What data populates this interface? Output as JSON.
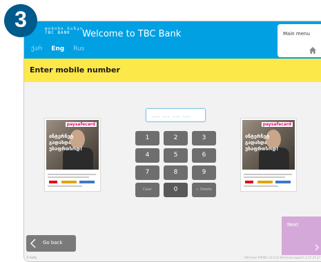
{
  "step_badge": "3",
  "header": {
    "logo_top": "თიბისი ბანკი",
    "logo_bottom": "TBC BANK",
    "welcome": "Welcome to TBC Bank",
    "languages": [
      {
        "label": "ქარ",
        "active": false
      },
      {
        "label": "Eng",
        "active": true
      },
      {
        "label": "Rus",
        "active": false
      }
    ],
    "main_menu": "Main menu",
    "home_icon": "home-icon"
  },
  "banner": {
    "title": "Enter mobile number"
  },
  "phone_input": {
    "mask": "___ ___ ___ ___"
  },
  "keypad": {
    "keys": [
      "1",
      "2",
      "3",
      "4",
      "5",
      "6",
      "7",
      "8",
      "9"
    ],
    "clear": "Clear",
    "zero": "0",
    "delete": "← Delete"
  },
  "ad": {
    "brand": "paysafecard",
    "headline": "ინტერნეტ გადახდა უსაფრთხოდ!"
  },
  "back_button": "Go back",
  "next_button": "Next",
  "footer_left": "© Kofty",
  "footer_right": "[Terminal #0000: v3.5.0]  Technical support: 2 27 27 27",
  "colors": {
    "header_blue": "#00a0e3",
    "banner_yellow": "#fde84a",
    "key_gray": "#6e6e6e",
    "next_purple": "#d4a9d9",
    "badge_blue": "#005a8c"
  }
}
